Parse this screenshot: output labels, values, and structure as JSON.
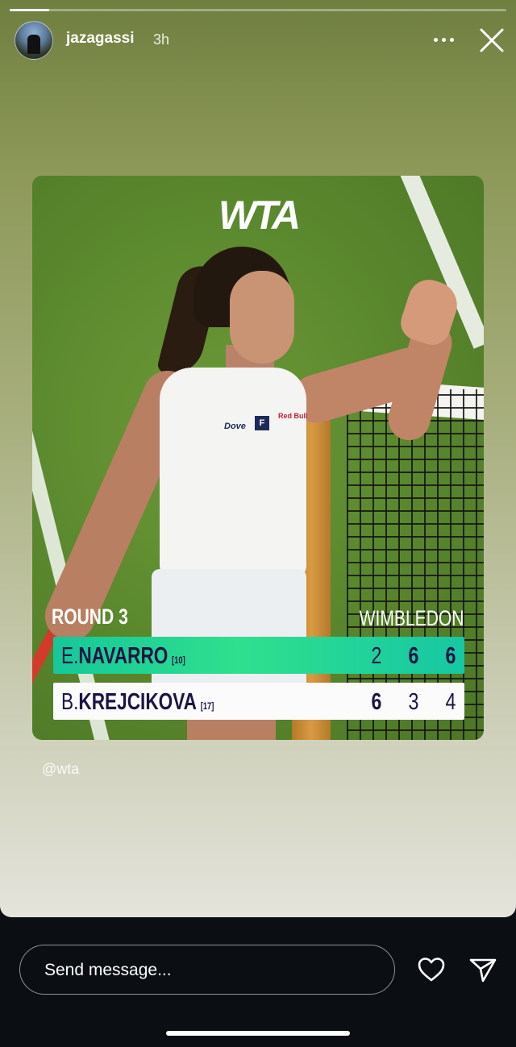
{
  "story": {
    "progress": 0.08,
    "username": "jazagassi",
    "time": "3h"
  },
  "card": {
    "brand": "WTA",
    "round": "ROUND 3",
    "event": "WIMBLEDON",
    "players": [
      {
        "initial": "E.",
        "surname": "NAVARRO",
        "seed": "[10]",
        "sets": [
          "2",
          "6",
          "6"
        ],
        "winner": true
      },
      {
        "initial": "B.",
        "surname": "KREJCIKOVA",
        "seed": "[17]",
        "sets": [
          "6",
          "3",
          "4"
        ],
        "winner": false
      }
    ],
    "sponsor_logos": [
      "Dove",
      "F",
      "Red Bull"
    ]
  },
  "mention": "@wta",
  "footer": {
    "message_placeholder": "Send message..."
  },
  "icons": [
    "more-icon",
    "close-icon",
    "heart-icon",
    "send-icon"
  ],
  "colors": {
    "winner_row": "#16c79a",
    "text_dark": "#1b1545"
  }
}
